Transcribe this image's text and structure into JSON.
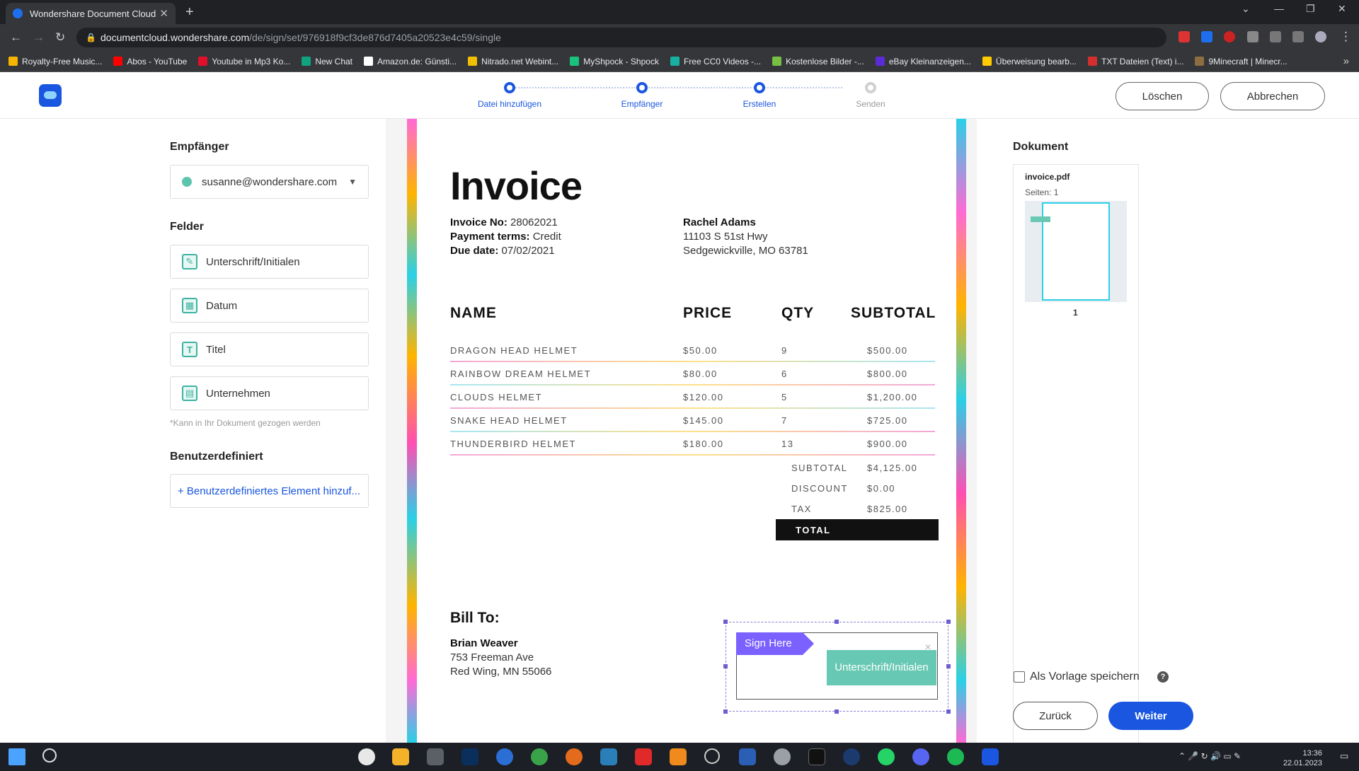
{
  "browser": {
    "tab_title": "Wondershare Document Cloud",
    "tab_close": "✕",
    "new_tab": "+",
    "url_host": "documentcloud.wondershare.com",
    "url_path": "/de/sign/set/976918f9cf3de876d7405a20523e4c59/single",
    "bookmarks": [
      {
        "label": "Royalty-Free Music...",
        "color": "#f5b400"
      },
      {
        "label": "Abos - YouTube",
        "color": "#ff0000"
      },
      {
        "label": "Youtube in Mp3 Ko...",
        "color": "#e0102b"
      },
      {
        "label": "New Chat",
        "color": "#10a37f"
      },
      {
        "label": "Amazon.de: Günsti...",
        "color": "#ffffff"
      },
      {
        "label": "Nitrado.net Webint...",
        "color": "#f0c000"
      },
      {
        "label": "MyShpock - Shpock",
        "color": "#19c37d"
      },
      {
        "label": "Free CC0 Videos -...",
        "color": "#16b1a0"
      },
      {
        "label": "Kostenlose Bilder -...",
        "color": "#77c043"
      },
      {
        "label": "eBay Kleinanzeigen...",
        "color": "#5b2bd6"
      },
      {
        "label": "Überweisung bearb...",
        "color": "#ffcc00"
      },
      {
        "label": "TXT Dateien (Text) i...",
        "color": "#d32f2f"
      },
      {
        "label": "9Minecraft | Minecr...",
        "color": "#8d6e3f"
      }
    ]
  },
  "header": {
    "steps": [
      {
        "label": "Datei hinzufügen",
        "active": true
      },
      {
        "label": "Empfänger",
        "active": true
      },
      {
        "label": "Erstellen",
        "active": true
      },
      {
        "label": "Senden",
        "active": false
      }
    ],
    "delete_label": "Löschen",
    "cancel_label": "Abbrechen"
  },
  "left": {
    "recipient_heading": "Empfänger",
    "recipient_value": "susanne@wondershare.com",
    "fields_heading": "Felder",
    "fields": [
      {
        "label": "Unterschrift/Initialen",
        "icon": "signature-icon"
      },
      {
        "label": "Datum",
        "icon": "calendar-icon"
      },
      {
        "label": "Titel",
        "icon": "title-icon"
      },
      {
        "label": "Unternehmen",
        "icon": "company-icon"
      }
    ],
    "fields_note": "*Kann in Ihr Dokument gezogen werden",
    "custom_heading": "Benutzerdefiniert",
    "custom_add": "+  Benutzerdefiniertes Element hinzuf..."
  },
  "invoice": {
    "title": "Invoice",
    "invoice_no_label": "Invoice No:",
    "invoice_no": "28062021",
    "payment_label": "Payment terms:",
    "payment": "Credit",
    "due_label": "Due date:",
    "due": "07/02/2021",
    "to_name": "Rachel Adams",
    "to_address1": "11103 S 51st Hwy",
    "to_address2": "Sedgewickville, MO 63781",
    "columns": [
      "NAME",
      "PRICE",
      "QTY",
      "SUBTOTAL"
    ],
    "rows": [
      {
        "name": "DRAGON HEAD HELMET",
        "price": "$50.00",
        "qty": "9",
        "subtotal": "$500.00"
      },
      {
        "name": "RAINBOW DREAM HELMET",
        "price": "$80.00",
        "qty": "6",
        "subtotal": "$800.00"
      },
      {
        "name": "CLOUDS HELMET",
        "price": "$120.00",
        "qty": "5",
        "subtotal": "$1,200.00"
      },
      {
        "name": "SNAKE HEAD HELMET",
        "price": "$145.00",
        "qty": "7",
        "subtotal": "$725.00"
      },
      {
        "name": "THUNDERBIRD HELMET",
        "price": "$180.00",
        "qty": "13",
        "subtotal": "$900.00"
      }
    ],
    "subtotal_label": "SUBTOTAL",
    "subtotal": "$4,125.00",
    "discount_label": "DISCOUNT",
    "discount": "$0.00",
    "tax_label": "TAX",
    "tax": "$825.00",
    "total_label": "TOTAL",
    "bill_to_heading": "Bill To:",
    "bill_name": "Brian Weaver",
    "bill_address1": "753 Freeman Ave",
    "bill_address2": "Red Wing, MN 55066",
    "sign_here": "Sign Here",
    "sig_field_label": "Unterschrift/Initialen"
  },
  "right": {
    "doc_heading": "Dokument",
    "file_name": "invoice.pdf",
    "pages": "Seiten: 1",
    "page_number": "1",
    "save_template": "Als Vorlage speichern",
    "help": "?",
    "back_label": "Zurück",
    "next_label": "Weiter"
  },
  "taskbar": {
    "time": "13:36",
    "date": "22.01.2023"
  },
  "colors": {
    "accent": "#1a56e0",
    "field_teal": "#67c8b3",
    "sign_purple": "#7b61ff"
  }
}
